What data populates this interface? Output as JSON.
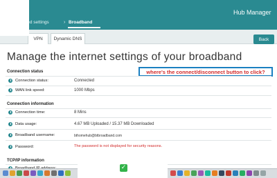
{
  "header": {
    "app_title": "Hub Manager",
    "breadcrumb": {
      "parent": "ced settings",
      "separator": "›",
      "current": "Broadband"
    },
    "back_label": "Back"
  },
  "tabs": [
    {
      "label": "VPN"
    },
    {
      "label": "Dynamic DNS"
    }
  ],
  "page": {
    "headline": "Manage the internet settings of your broadband"
  },
  "annotation": {
    "text": "where's the connect/disconnect button to click?",
    "border_color": "#1a7fc1",
    "text_color": "#d22b2b"
  },
  "sections": {
    "connection_status": {
      "title": "Connection status",
      "rows": [
        {
          "label": "Connection status:",
          "value": "Connected"
        },
        {
          "label": "WAN link speed:",
          "value": "1000 Mbps"
        }
      ]
    },
    "connection_information": {
      "title": "Connection information",
      "rows": [
        {
          "label": "Connection time:",
          "value": "8 Mins"
        },
        {
          "label": "Data usage:",
          "value": "4.67 MB Uploaded / 15.37 MB Downloaded"
        },
        {
          "label": "Broadband username:",
          "value": "bthomehub@btbroadband.com"
        },
        {
          "label": "Password:",
          "value": "The password is not displayed for security reasons."
        }
      ]
    },
    "tcpip_information": {
      "title": "TCP/IP information",
      "rows": [
        {
          "label": "Broadband IP address:",
          "value": ""
        }
      ]
    }
  },
  "colors": {
    "brand": "#2a8a91",
    "warning_text": "#d22b2b"
  },
  "toast": {
    "icon": "check-icon"
  }
}
